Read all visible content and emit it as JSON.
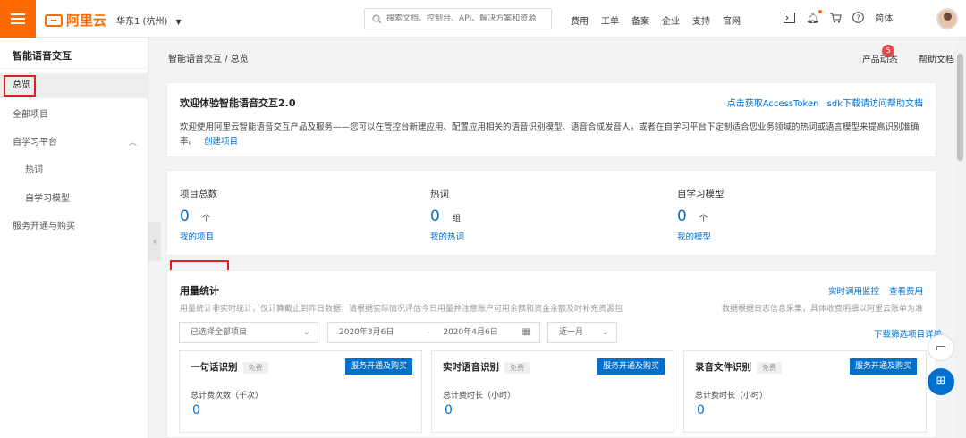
{
  "topbar": {
    "logo_text": "阿里云",
    "region": "华东1 (杭州)",
    "search_placeholder": "搜索文档、控制台、API、解决方案和资源",
    "nav": [
      "费用",
      "工单",
      "备案",
      "企业",
      "支持",
      "官网"
    ],
    "language": "简体"
  },
  "sidebar": {
    "title": "智能语音交互",
    "items": [
      {
        "label": "总览"
      },
      {
        "label": "全部项目"
      },
      {
        "label": "自学习平台"
      },
      {
        "label": "热词"
      },
      {
        "label": "自学习模型"
      },
      {
        "label": "服务开通与购买"
      }
    ]
  },
  "header": {
    "breadcrumb": "智能语音交互  /  总览",
    "product_updates": "产品动态",
    "product_updates_badge": "5",
    "help_docs": "帮助文档"
  },
  "welcome": {
    "title": "欢迎体验智能语音交互2.0",
    "link_token": "点击获取AccessToken",
    "link_sdk": "sdk下载请访问帮助文档",
    "text_line1": "欢迎使用阿里云智能语音交互产品及服务——您可以在管控台新建应用、配置应用相关的语音识别模型、语音合成发音人，或者在自学习平台下定制适合您业务领域的热词或语言模型来提高识别准确",
    "text_line2": "率。",
    "create_link": "创建项目"
  },
  "stats": [
    {
      "label": "项目总数",
      "value": "0",
      "unit": "个",
      "link": "我的项目"
    },
    {
      "label": "热词",
      "value": "0",
      "unit": "组",
      "link": "我的热词"
    },
    {
      "label": "自学习模型",
      "value": "0",
      "unit": "个",
      "link": "我的模型"
    }
  ],
  "usage": {
    "title": "用量统计",
    "link_monitor": "实时调用监控",
    "link_fee": "查看费用",
    "note_left": "用量统计非实时统计，仅计算截止到昨日数据，请根据实际情况评估今日用量并注意账户可用余额和资金余额及时补充资源包",
    "note_right": "数据根据日志信息采集，具体收费明细以阿里云账单为准",
    "project_select": "已选择全部项目",
    "date_start": "2020年3月6日",
    "date_sep": "-",
    "date_end": "2020年4月6日",
    "range": "近一月",
    "download": "下载筛选项目详单",
    "cards": [
      {
        "title": "一句话识别",
        "free": "免费",
        "button": "服务开通及购买",
        "metric": "总计费次数（千次）",
        "value": "0"
      },
      {
        "title": "实时语音识别",
        "free": "免费",
        "button": "服务开通及购买",
        "metric": "总计费时长（小时）",
        "value": "0"
      },
      {
        "title": "录音文件识别",
        "free": "免费",
        "button": "服务开通及购买",
        "metric": "总计费时长（小时）",
        "value": "0"
      }
    ]
  }
}
